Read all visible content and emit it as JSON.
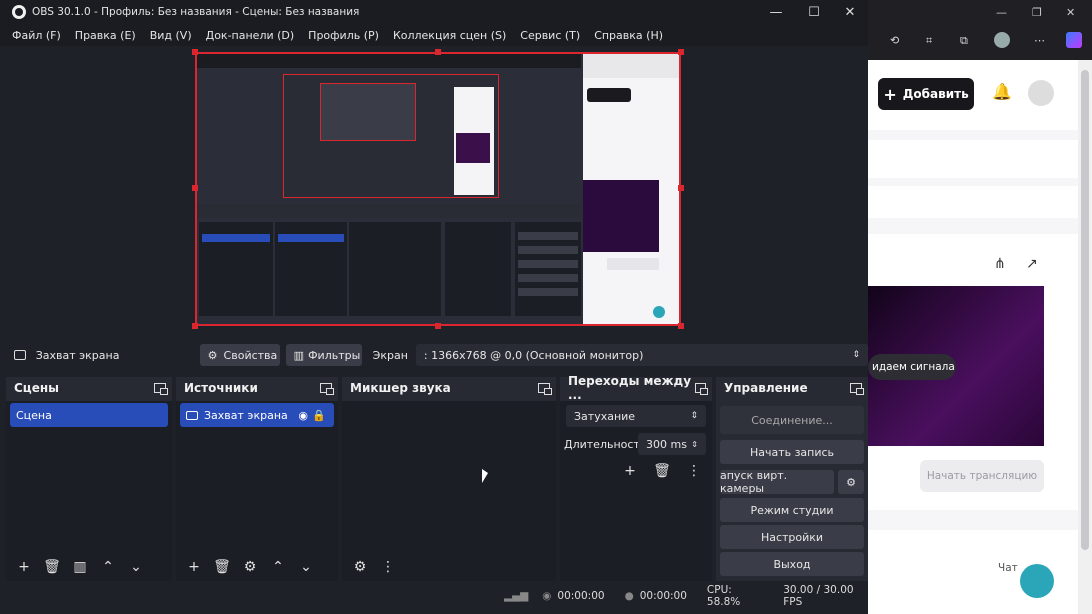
{
  "window": {
    "title": "OBS 30.1.0 - Профиль: Без названия - Сцены: Без названия",
    "min": "—",
    "max": "☐",
    "close": "✕"
  },
  "menu": [
    "Файл (F)",
    "Правка (E)",
    "Вид (V)",
    "Док-панели (D)",
    "Профиль (P)",
    "Коллекция сцен (S)",
    "Сервис (T)",
    "Справка (H)"
  ],
  "source_toolbar": {
    "source_name": "Захват экрана",
    "properties": "Свойства",
    "filters": "Фильтры",
    "screen_label": "Экран",
    "screen_value": ": 1366x768 @ 0,0 (Основной монитор)"
  },
  "docks": {
    "scenes": {
      "title": "Сцены",
      "items": [
        "Сцена"
      ]
    },
    "sources": {
      "title": "Источники",
      "items": [
        "Захват экрана"
      ]
    },
    "mixer": {
      "title": "Микшер звука"
    },
    "transitions": {
      "title": "Переходы между ...",
      "type": "Затухание",
      "duration_label": "Длительность",
      "duration_value": "300 ms"
    },
    "controls": {
      "title": "Управление",
      "connecting": "Соединение...",
      "record": "Начать запись",
      "virtual_cam": "апуск вирт. камеры",
      "studio": "Режим студии",
      "settings": "Настройки",
      "exit": "Выход"
    }
  },
  "status": {
    "stream_time": "00:00:00",
    "record_time": "00:00:00",
    "cpu": "CPU: 58.8%",
    "fps": "30.00 / 30.00 FPS"
  },
  "browser": {
    "add_button": "Добавить",
    "signal_text": "идаем сигнала",
    "start_stream": "Начать трансляцию",
    "chat": "Чат"
  },
  "colors": {
    "accent_selected": "#284cb8",
    "preview_border": "#d9262f",
    "panel_bg": "#272a33"
  }
}
